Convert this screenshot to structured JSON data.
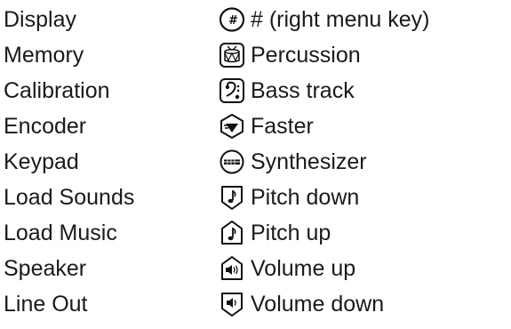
{
  "rows": [
    {
      "name": "Display",
      "icon": "hash-key-icon",
      "label": "# (right menu key)"
    },
    {
      "name": "Memory",
      "icon": "drum-icon",
      "label": "Percussion"
    },
    {
      "name": "Calibration",
      "icon": "bass-clef-icon",
      "label": "Bass track"
    },
    {
      "name": "Encoder",
      "icon": "faster-icon",
      "label": "Faster"
    },
    {
      "name": "Keypad",
      "icon": "synthesizer-icon",
      "label": "Synthesizer"
    },
    {
      "name": "Load Sounds",
      "icon": "pitch-down-icon",
      "label": "Pitch down"
    },
    {
      "name": "Load Music",
      "icon": "pitch-up-icon",
      "label": "Pitch up"
    },
    {
      "name": "Speaker",
      "icon": "volume-up-icon",
      "label": "Volume up"
    },
    {
      "name": "Line Out",
      "icon": "volume-down-icon",
      "label": "Volume down"
    }
  ]
}
